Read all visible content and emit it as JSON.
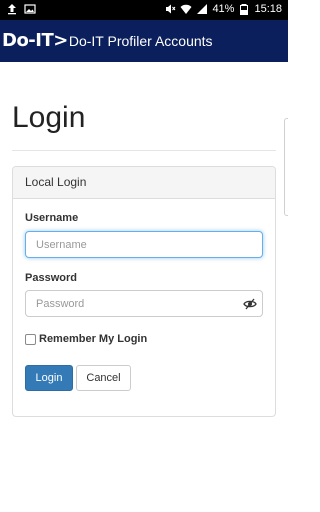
{
  "status_bar": {
    "battery_percent": "41%",
    "time": "15:18",
    "icons": [
      "upload-icon",
      "image-icon",
      "mute-icon",
      "wifi-icon",
      "signal-icon",
      "battery-icon"
    ]
  },
  "app_bar": {
    "logo_text": "Do-IT>",
    "title": "Do-IT Profiler Accounts",
    "background_color": "#0a1f5c"
  },
  "page": {
    "title": "Login"
  },
  "login_panel": {
    "heading": "Local Login",
    "username": {
      "label": "Username",
      "placeholder": "Username",
      "value": ""
    },
    "password": {
      "label": "Password",
      "placeholder": "Password",
      "value": ""
    },
    "remember": {
      "label": "Remember My Login",
      "checked": false
    },
    "login_button": "Login",
    "cancel_button": "Cancel",
    "primary_color": "#337ab7"
  }
}
